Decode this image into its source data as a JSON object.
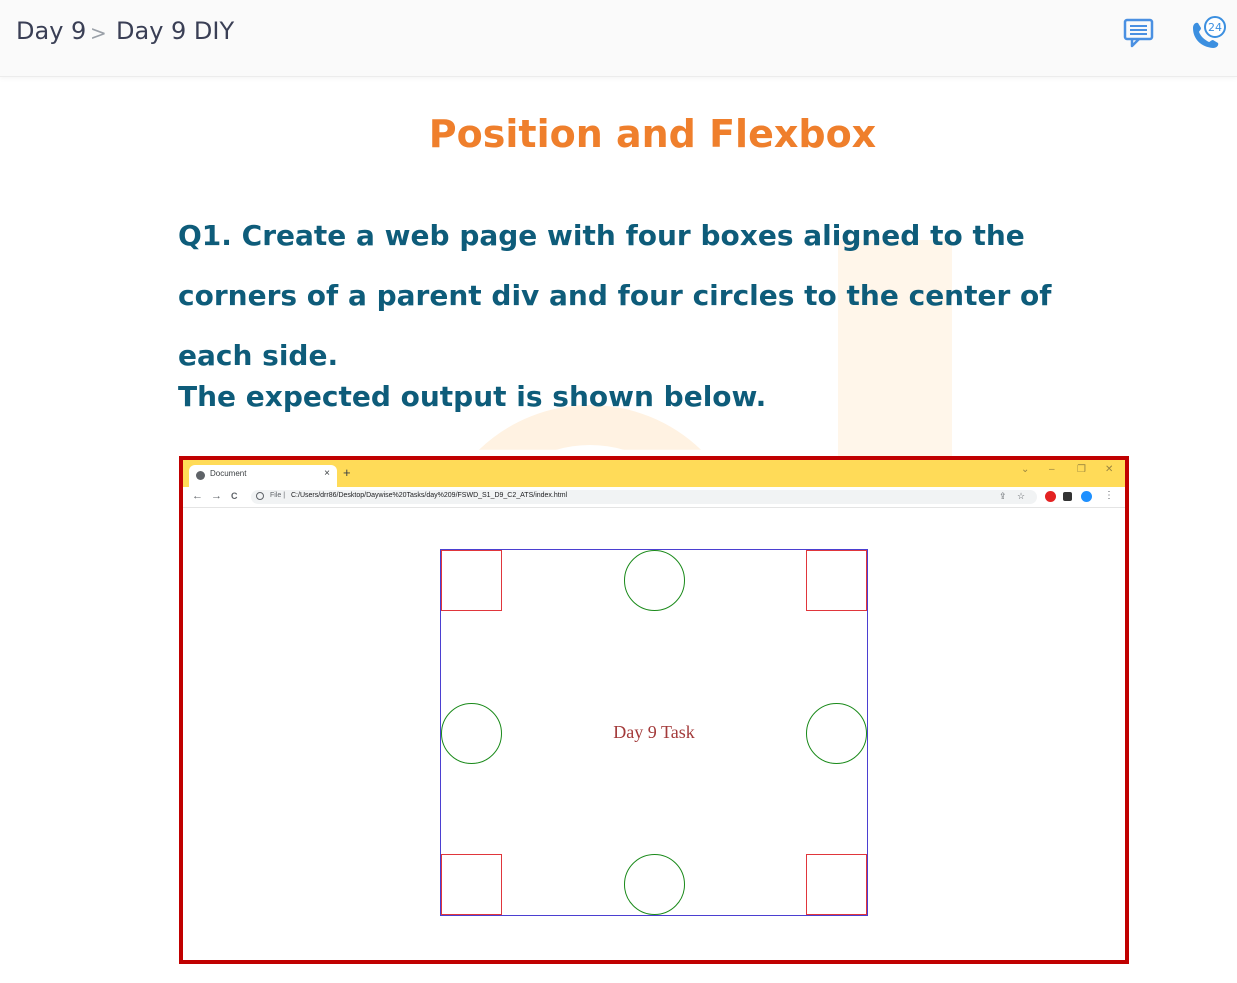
{
  "breadcrumb": {
    "items": [
      "Day 9",
      "Day 9 DIY"
    ],
    "separator": ">"
  },
  "header_icons": {
    "chat": "chat-icon",
    "support": "phone-support-icon",
    "support_badge": "24"
  },
  "content": {
    "title": "Position and Flexbox",
    "question": "Q1. Create a web page with four boxes aligned to the corners of a parent div and four circles to the center of each side.",
    "expected": "The expected output is shown below."
  },
  "screenshot": {
    "tab_title": "Document",
    "tab_close": "×",
    "new_tab": "+",
    "window_controls": [
      "⌄",
      "–",
      "❐",
      "✕"
    ],
    "nav": [
      "←",
      "→",
      "C"
    ],
    "address_prefix": "File |",
    "address_url": "C:/Users/drr86/Desktop/Daywise%20Tasks/day%209/FSWD_S1_D9_C2_ATS/index.html",
    "page_text": "Day 9 Task"
  },
  "colors": {
    "title": "#ef7f2c",
    "question": "#0e5c7a",
    "frame_border": "#c00000",
    "tab_strip": "#ffdb58",
    "parent_border": "#4b3fd1",
    "box_border": "#e0363b",
    "circle_border": "#1a8a1a",
    "task_text": "#a33a3a"
  }
}
